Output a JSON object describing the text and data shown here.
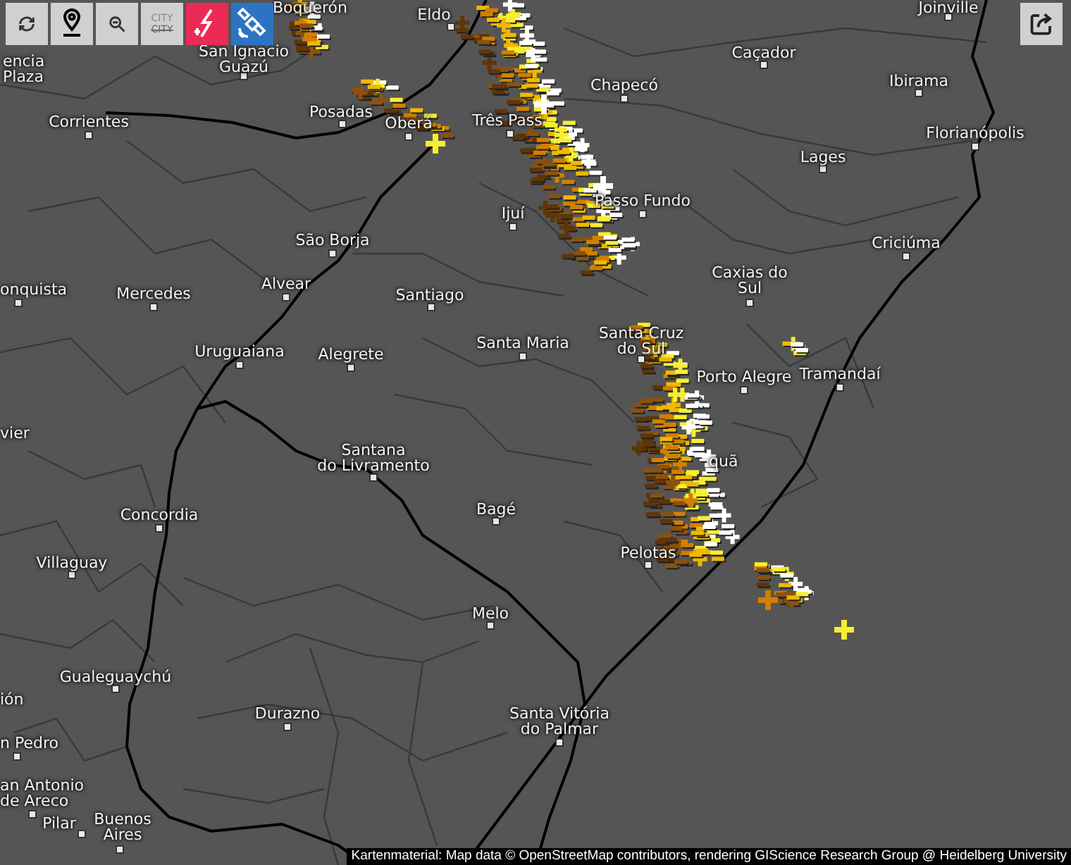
{
  "toolbar": [
    {
      "kind": "refresh"
    },
    {
      "kind": "locate"
    },
    {
      "kind": "zoom-out"
    },
    {
      "kind": "city-labels",
      "label": "CITY",
      "struck_label": "CITY",
      "selected": false
    },
    {
      "kind": "lightning",
      "selected": true
    },
    {
      "kind": "satellite",
      "selected": true
    }
  ],
  "share_button": {
    "kind": "share"
  },
  "cities": [
    {
      "lines": [
        "Boquerón"
      ]
    },
    {
      "lines": [
        "Eldo"
      ]
    },
    {
      "lines": [
        "San Ignacio",
        "Guazú"
      ]
    },
    {
      "lines": [
        "encia",
        "Plaza"
      ]
    },
    {
      "lines": [
        "Corrientes"
      ]
    },
    {
      "lines": [
        "Posadas"
      ]
    },
    {
      "lines": [
        "Oberá"
      ]
    },
    {
      "lines": [
        "Três Pass"
      ]
    },
    {
      "lines": [
        "Chapecó"
      ]
    },
    {
      "lines": [
        "Caçador"
      ]
    },
    {
      "lines": [
        "Joinville"
      ]
    },
    {
      "lines": [
        "Ibirama"
      ]
    },
    {
      "lines": [
        "Florianópolis"
      ]
    },
    {
      "lines": [
        "Lages"
      ]
    },
    {
      "lines": [
        "Passo Fundo"
      ]
    },
    {
      "lines": [
        "Ijuí"
      ]
    },
    {
      "lines": [
        "São Borja"
      ]
    },
    {
      "lines": [
        "Criciúma"
      ]
    },
    {
      "lines": [
        "onquista"
      ]
    },
    {
      "lines": [
        "Mercedes"
      ]
    },
    {
      "lines": [
        "Alvear"
      ]
    },
    {
      "lines": [
        "Santiago"
      ]
    },
    {
      "lines": [
        "Caxias do",
        "Sul"
      ]
    },
    {
      "lines": [
        "Santa Maria"
      ]
    },
    {
      "lines": [
        "Uruguaiana"
      ]
    },
    {
      "lines": [
        "Alegrete"
      ]
    },
    {
      "lines": [
        "Santa Cruz",
        "do Sul"
      ]
    },
    {
      "lines": [
        "Porto Alegre"
      ]
    },
    {
      "lines": [
        "Tramandaí"
      ]
    },
    {
      "lines": [
        "vier"
      ]
    },
    {
      "lines": [
        "Santana",
        "do Livramento"
      ]
    },
    {
      "lines": [
        "quã"
      ]
    },
    {
      "lines": [
        "Concordia"
      ]
    },
    {
      "lines": [
        "Bagé"
      ]
    },
    {
      "lines": [
        "Pelotas"
      ]
    },
    {
      "lines": [
        "Villaguay"
      ]
    },
    {
      "lines": [
        "Melo"
      ]
    },
    {
      "lines": [
        "Gualeguaychú"
      ]
    },
    {
      "lines": [
        "ión"
      ]
    },
    {
      "lines": [
        "Durazno"
      ]
    },
    {
      "lines": [
        "Santa Vitória",
        "do Palmar"
      ]
    },
    {
      "lines": [
        "n Pedro"
      ]
    },
    {
      "lines": [
        "an Antonio",
        "de Areco"
      ]
    },
    {
      "lines": [
        "Pilar"
      ]
    },
    {
      "lines": [
        "Buenos",
        "Aires"
      ]
    }
  ],
  "attribution": "Kartenmaterial: Map data © OpenStreetMap contributors, rendering GIScience Research Group @ Heidelberg University"
}
